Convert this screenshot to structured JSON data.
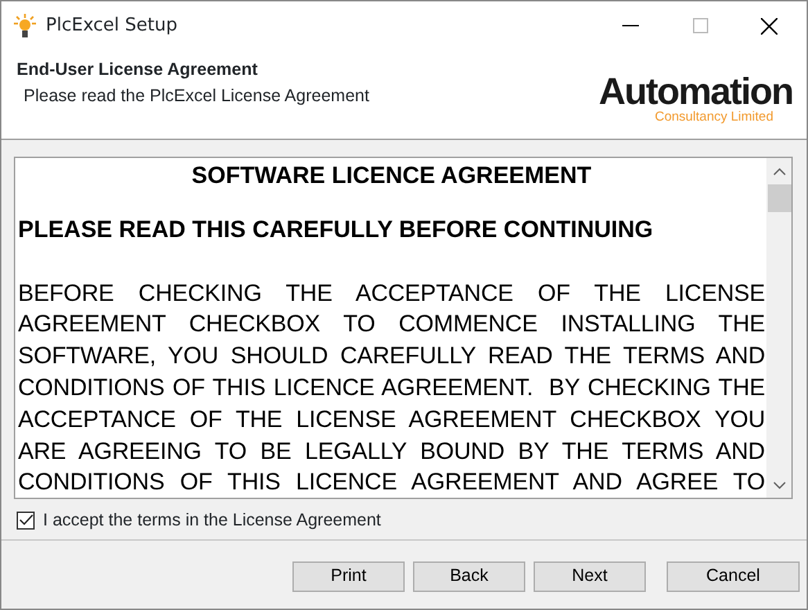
{
  "window": {
    "title": "PlcExcel Setup"
  },
  "header": {
    "title": "End-User License Agreement",
    "subtitle": "Please read the PlcExcel License Agreement",
    "logo": {
      "name": "Automation",
      "tagline": "Consultancy Limited"
    }
  },
  "license": {
    "heading": "SOFTWARE LICENCE AGREEMENT",
    "subheading": "PLEASE READ THIS CAREFULLY BEFORE CONTINUING",
    "body": "BEFORE CHECKING THE ACCEPTANCE OF THE LICENSE AGREEMENT CHECKBOX TO COMMENCE INSTALLING THE SOFTWARE, YOU SHOULD CAREFULLY READ THE TERMS AND CONDITIONS OF THIS LICENCE AGREEMENT.  BY CHECKING THE ACCEPTANCE OF THE LICENSE AGREEMENT CHECKBOX YOU ARE AGREEING TO BE LEGALLY BOUND BY THE TERMS AND CONDITIONS OF THIS LICENCE AGREEMENT AND AGREE TO"
  },
  "accept": {
    "label": "I accept the terms in the License Agreement",
    "checked": true
  },
  "buttons": [
    {
      "label": "Print"
    },
    {
      "label": "Back"
    },
    {
      "label": "Next"
    },
    {
      "label": "Cancel"
    }
  ]
}
